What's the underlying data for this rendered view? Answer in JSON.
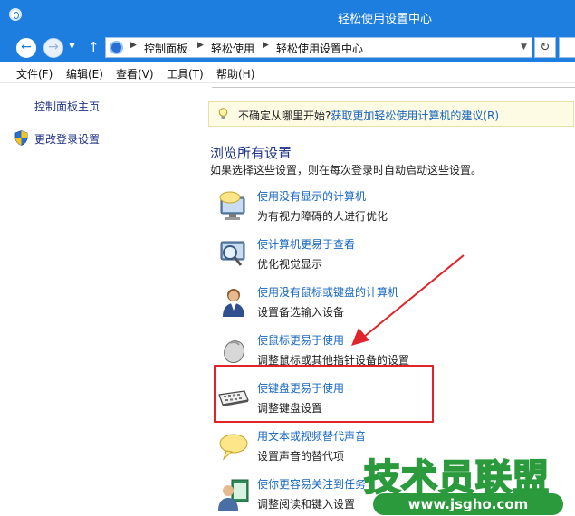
{
  "window": {
    "title": "轻松使用设置中心"
  },
  "address_bar": {
    "crumbs": [
      "控制面板",
      "轻松使用",
      "轻松使用设置中心"
    ]
  },
  "menu": {
    "items": [
      "文件(F)",
      "编辑(E)",
      "查看(V)",
      "工具(T)",
      "帮助(H)"
    ]
  },
  "sidebar": {
    "items": [
      "控制面板主页",
      "更改登录设置"
    ]
  },
  "tip": {
    "prefix": "不确定从哪里开始?",
    "link": "获取更加轻松使用计算机的建议(R)"
  },
  "section": {
    "title": "浏览所有设置",
    "description": "如果选择这些设置，则在每次登录时自动启动这些设置。"
  },
  "options": [
    {
      "label": "使用没有显示的计算机",
      "description": "为有视力障碍的人进行优化",
      "icon": "speech-monitor-icon"
    },
    {
      "label": "使计算机更易于查看",
      "description": "优化视觉显示",
      "icon": "magnifier-monitor-icon"
    },
    {
      "label": "使用没有鼠标或键盘的计算机",
      "description": "设置备选输入设备",
      "icon": "person-icon"
    },
    {
      "label": "使鼠标更易于使用",
      "description": "调整鼠标或其他指针设备的设置",
      "icon": "mouse-icon"
    },
    {
      "label": "使键盘更易于使用",
      "description": "调整键盘设置",
      "icon": "keyboard-icon"
    },
    {
      "label": "用文本或视频替代声音",
      "description": "设置声音的替代项",
      "icon": "speech-bubble-icon"
    },
    {
      "label": "使你更容易关注到任务",
      "description": "调整阅读和键入设置",
      "icon": "person-window-icon"
    }
  ],
  "watermark": {
    "title": "技术员联盟",
    "url": "www.jsgho.com"
  },
  "colors": {
    "titlebar": "#1e7ee0",
    "link": "#1565c0",
    "heading": "#1e3287",
    "highlight": "#e1232b",
    "watermark": "#2b9a3c"
  }
}
